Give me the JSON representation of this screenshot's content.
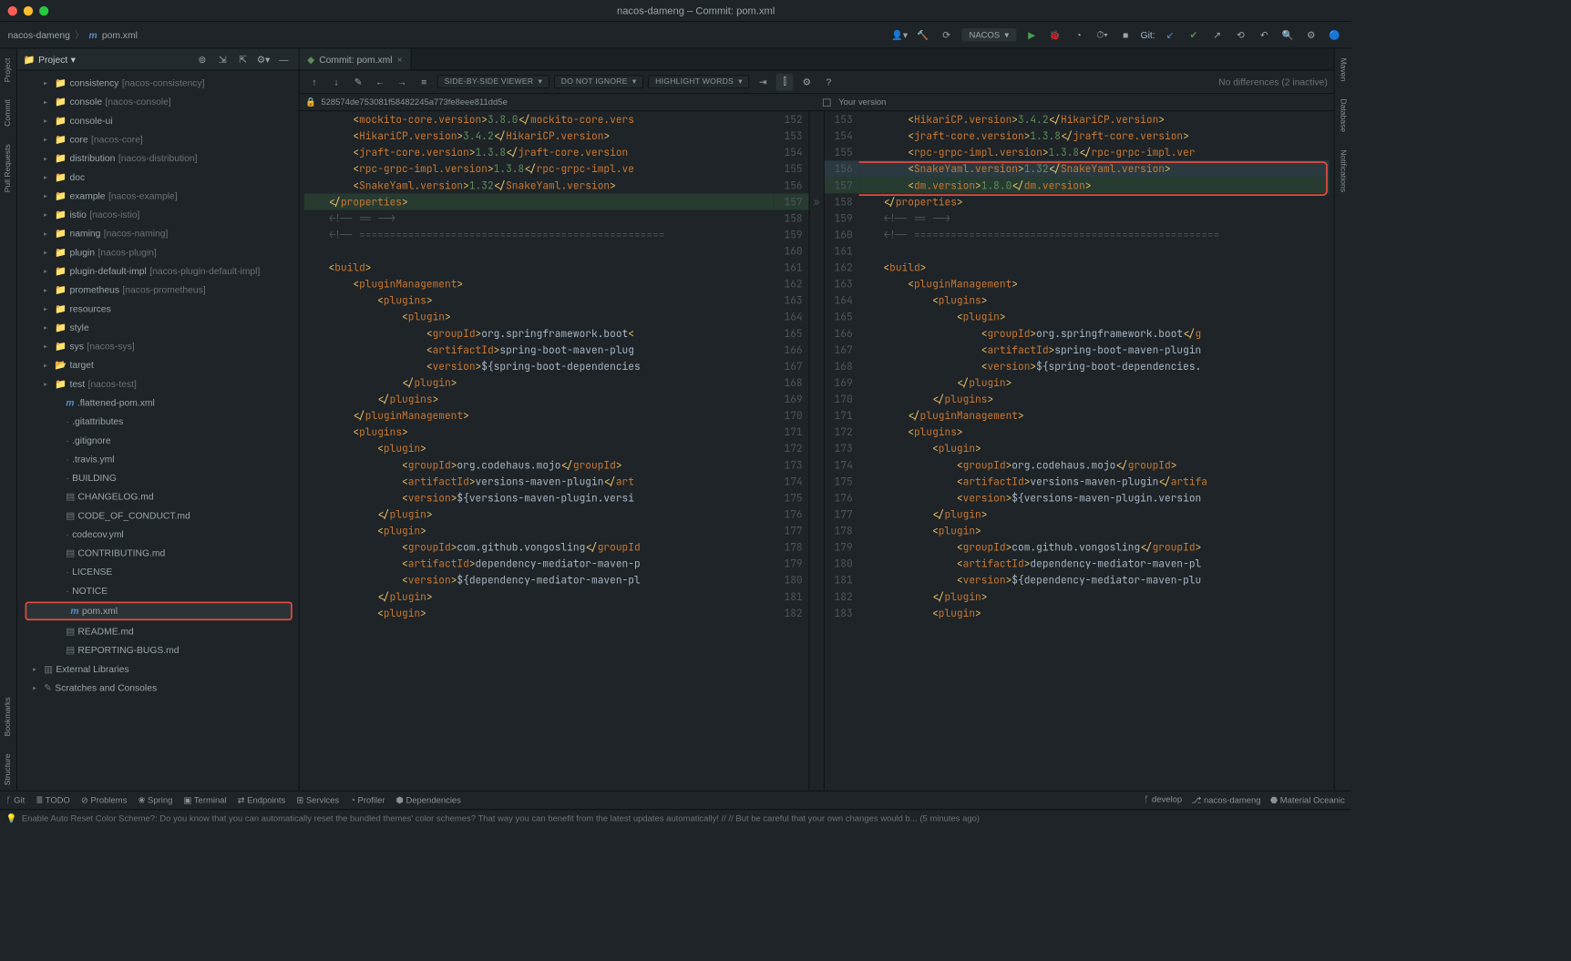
{
  "title": "nacos-dameng – Commit: pom.xml",
  "breadcrumb": {
    "project": "nacos-dameng",
    "file": "pom.xml"
  },
  "runConfig": {
    "label": "NACOS"
  },
  "gitLabel": "Git:",
  "panel": {
    "title": "Project"
  },
  "tree": [
    {
      "chev": "▸",
      "icon": "folder",
      "label": "consistency",
      "mod": "[nacos-consistency]",
      "indent": 2
    },
    {
      "chev": "▸",
      "icon": "folder",
      "label": "console",
      "mod": "[nacos-console]",
      "indent": 2
    },
    {
      "chev": "▸",
      "icon": "folder",
      "label": "console-ui",
      "mod": "",
      "indent": 2
    },
    {
      "chev": "▸",
      "icon": "folder",
      "label": "core",
      "mod": "[nacos-core]",
      "indent": 2
    },
    {
      "chev": "▸",
      "icon": "folder",
      "label": "distribution",
      "mod": "[nacos-distribution]",
      "indent": 2
    },
    {
      "chev": "▸",
      "icon": "folder",
      "label": "doc",
      "mod": "",
      "indent": 2
    },
    {
      "chev": "▸",
      "icon": "folder",
      "label": "example",
      "mod": "[nacos-example]",
      "indent": 2
    },
    {
      "chev": "▸",
      "icon": "folder",
      "label": "istio",
      "mod": "[nacos-istio]",
      "indent": 2
    },
    {
      "chev": "▸",
      "icon": "folder",
      "label": "naming",
      "mod": "[nacos-naming]",
      "indent": 2
    },
    {
      "chev": "▸",
      "icon": "folder",
      "label": "plugin",
      "mod": "[nacos-plugin]",
      "indent": 2
    },
    {
      "chev": "▸",
      "icon": "folder",
      "label": "plugin-default-impl",
      "mod": "[nacos-plugin-default-impl]",
      "indent": 2
    },
    {
      "chev": "▸",
      "icon": "folder",
      "label": "prometheus",
      "mod": "[nacos-prometheus]",
      "indent": 2
    },
    {
      "chev": "▸",
      "icon": "folder",
      "label": "resources",
      "mod": "",
      "indent": 2
    },
    {
      "chev": "▸",
      "icon": "folder",
      "label": "style",
      "mod": "",
      "indent": 2
    },
    {
      "chev": "▸",
      "icon": "folder",
      "label": "sys",
      "mod": "[nacos-sys]",
      "indent": 2
    },
    {
      "chev": "▸",
      "icon": "folder-open",
      "label": "target",
      "mod": "",
      "indent": 2
    },
    {
      "chev": "▸",
      "icon": "folder",
      "label": "test",
      "mod": "[nacos-test]",
      "indent": 2
    },
    {
      "chev": "",
      "icon": "m",
      "label": ".flattened-pom.xml",
      "mod": "",
      "indent": 3
    },
    {
      "chev": "",
      "icon": "file",
      "label": ".gitattributes",
      "mod": "",
      "indent": 3
    },
    {
      "chev": "",
      "icon": "file",
      "label": ".gitignore",
      "mod": "",
      "indent": 3
    },
    {
      "chev": "",
      "icon": "file",
      "label": ".travis.yml",
      "mod": "",
      "indent": 3
    },
    {
      "chev": "",
      "icon": "file",
      "label": "BUILDING",
      "mod": "",
      "indent": 3
    },
    {
      "chev": "",
      "icon": "md",
      "label": "CHANGELOG.md",
      "mod": "",
      "indent": 3
    },
    {
      "chev": "",
      "icon": "md",
      "label": "CODE_OF_CONDUCT.md",
      "mod": "",
      "indent": 3
    },
    {
      "chev": "",
      "icon": "file",
      "label": "codecov.yml",
      "mod": "",
      "indent": 3
    },
    {
      "chev": "",
      "icon": "md",
      "label": "CONTRIBUTING.md",
      "mod": "",
      "indent": 3
    },
    {
      "chev": "",
      "icon": "file",
      "label": "LICENSE",
      "mod": "",
      "indent": 3
    },
    {
      "chev": "",
      "icon": "file",
      "label": "NOTICE",
      "mod": "",
      "indent": 3
    },
    {
      "chev": "",
      "icon": "m",
      "label": "pom.xml",
      "mod": "",
      "indent": 3,
      "selected": true,
      "boxed": true
    },
    {
      "chev": "",
      "icon": "md",
      "label": "README.md",
      "mod": "",
      "indent": 3
    },
    {
      "chev": "",
      "icon": "md",
      "label": "REPORTING-BUGS.md",
      "mod": "",
      "indent": 3
    },
    {
      "chev": "▸",
      "icon": "lib",
      "label": "External Libraries",
      "mod": "",
      "indent": 1
    },
    {
      "chev": "▸",
      "icon": "scratch",
      "label": "Scratches and Consoles",
      "mod": "",
      "indent": 1
    }
  ],
  "tab": {
    "label": "Commit: pom.xml"
  },
  "diffToolbar": {
    "viewer": "SIDE-BY-SIDE VIEWER",
    "ignore": "DO NOT IGNORE",
    "highlight": "HIGHLIGHT WORDS",
    "noDiff": "No differences (2 inactive)"
  },
  "diffHead": {
    "leftHash": "528574de753081f58482245a773fe8eee811dd5e",
    "rightLabel": "Your version"
  },
  "leftLines": [
    {
      "n": 152,
      "html": "        <span class='tag'>&lt;</span><span class='tagname'>mockito-core.version</span><span class='tag'>&gt;</span><span class='text-val'>3.8.0</span><span class='tag'>&lt;/</span><span class='close-tag'>mockito-core.vers</span>"
    },
    {
      "n": 153,
      "html": "        <span class='tag'>&lt;</span><span class='tagname'>HikariCP.version</span><span class='tag'>&gt;</span><span class='text-val'>3.4.2</span><span class='tag'>&lt;/</span><span class='close-tag'>HikariCP.version</span><span class='tag'>&gt;</span>"
    },
    {
      "n": 154,
      "html": "        <span class='tag'>&lt;</span><span class='tagname'>jraft-core.version</span><span class='tag'>&gt;</span><span class='text-val'>1.3.8</span><span class='tag'>&lt;/</span><span class='close-tag'>jraft-core.version</span>"
    },
    {
      "n": 155,
      "html": "        <span class='tag'>&lt;</span><span class='tagname'>rpc-grpc-impl.version</span><span class='tag'>&gt;</span><span class='text-val'>1.3.8</span><span class='tag'>&lt;/</span><span class='close-tag'>rpc-grpc-impl.ve</span>"
    },
    {
      "n": 156,
      "html": "        <span class='tag'>&lt;</span><span class='tagname'>SnakeYaml.version</span><span class='tag'>&gt;</span><span class='text-val'>1.32</span><span class='tag'>&lt;/</span><span class='close-tag'>SnakeYaml.version</span><span class='tag'>&gt;</span>"
    },
    {
      "n": 157,
      "cls": "ins",
      "html": "    <span class='tag'>&lt;/</span><span class='close-tag'>properties</span><span class='tag'>&gt;</span>"
    },
    {
      "n": 158,
      "html": "    <span class='comm'>&lt;!-- == --&gt;</span>"
    },
    {
      "n": 159,
      "html": "    <span class='comm'>&lt;!-- ==================================================</span>"
    },
    {
      "n": 160,
      "html": ""
    },
    {
      "n": 161,
      "html": "    <span class='tag'>&lt;</span><span class='tagname'>build</span><span class='tag'>&gt;</span>"
    },
    {
      "n": 162,
      "html": "        <span class='tag'>&lt;</span><span class='tagname'>pluginManagement</span><span class='tag'>&gt;</span>"
    },
    {
      "n": 163,
      "html": "            <span class='tag'>&lt;</span><span class='tagname'>plugins</span><span class='tag'>&gt;</span>"
    },
    {
      "n": 164,
      "html": "                <span class='tag'>&lt;</span><span class='tagname'>plugin</span><span class='tag'>&gt;</span>"
    },
    {
      "n": 165,
      "html": "                    <span class='tag'>&lt;</span><span class='tagname'>groupId</span><span class='tag'>&gt;</span><span class='attr'>org.springframework.boot</span><span class='tag'>&lt;</span>"
    },
    {
      "n": 166,
      "html": "                    <span class='tag'>&lt;</span><span class='tagname'>artifactId</span><span class='tag'>&gt;</span><span class='attr'>spring-boot-maven-plug</span>"
    },
    {
      "n": 167,
      "html": "                    <span class='tag'>&lt;</span><span class='tagname'>version</span><span class='tag'>&gt;</span><span class='attr'>${spring-boot-dependencies</span>"
    },
    {
      "n": 168,
      "html": "                <span class='tag'>&lt;/</span><span class='close-tag'>plugin</span><span class='tag'>&gt;</span>"
    },
    {
      "n": 169,
      "html": "            <span class='tag'>&lt;/</span><span class='close-tag'>plugins</span><span class='tag'>&gt;</span>"
    },
    {
      "n": 170,
      "html": "        <span class='tag'>&lt;/</span><span class='close-tag'>pluginManagement</span><span class='tag'>&gt;</span>"
    },
    {
      "n": 171,
      "html": "        <span class='tag'>&lt;</span><span class='tagname'>plugins</span><span class='tag'>&gt;</span>"
    },
    {
      "n": 172,
      "html": "            <span class='tag'>&lt;</span><span class='tagname'>plugin</span><span class='tag'>&gt;</span>"
    },
    {
      "n": 173,
      "html": "                <span class='tag'>&lt;</span><span class='tagname'>groupId</span><span class='tag'>&gt;</span><span class='attr'>org.codehaus.mojo</span><span class='tag'>&lt;/</span><span class='close-tag'>groupId</span><span class='tag'>&gt;</span>"
    },
    {
      "n": 174,
      "html": "                <span class='tag'>&lt;</span><span class='tagname'>artifactId</span><span class='tag'>&gt;</span><span class='attr'>versions-maven-plugin</span><span class='tag'>&lt;/</span><span class='close-tag'>art</span>"
    },
    {
      "n": 175,
      "html": "                <span class='tag'>&lt;</span><span class='tagname'>version</span><span class='tag'>&gt;</span><span class='attr'>${versions-maven-plugin.versi</span>"
    },
    {
      "n": 176,
      "html": "            <span class='tag'>&lt;/</span><span class='close-tag'>plugin</span><span class='tag'>&gt;</span>"
    },
    {
      "n": 177,
      "html": "            <span class='tag'>&lt;</span><span class='tagname'>plugin</span><span class='tag'>&gt;</span>"
    },
    {
      "n": 178,
      "html": "                <span class='tag'>&lt;</span><span class='tagname'>groupId</span><span class='tag'>&gt;</span><span class='attr'>com.github.vongosling</span><span class='tag'>&lt;/</span><span class='close-tag'>groupId</span>"
    },
    {
      "n": 179,
      "html": "                <span class='tag'>&lt;</span><span class='tagname'>artifactId</span><span class='tag'>&gt;</span><span class='attr'>dependency-mediator-maven-p</span>"
    },
    {
      "n": 180,
      "html": "                <span class='tag'>&lt;</span><span class='tagname'>version</span><span class='tag'>&gt;</span><span class='attr'>${dependency-mediator-maven-pl</span>"
    },
    {
      "n": 181,
      "html": "            <span class='tag'>&lt;/</span><span class='close-tag'>plugin</span><span class='tag'>&gt;</span>"
    },
    {
      "n": 182,
      "html": "            <span class='tag'>&lt;</span><span class='tagname'>plugin</span><span class='tag'>&gt;</span>"
    }
  ],
  "rightLines": [
    {
      "n": 153,
      "html": "        <span class='tag'>&lt;</span><span class='tagname'>HikariCP.version</span><span class='tag'>&gt;</span><span class='text-val'>3.4.2</span><span class='tag'>&lt;/</span><span class='close-tag'>HikariCP.version</span><span class='tag'>&gt;</span>"
    },
    {
      "n": 154,
      "html": "        <span class='tag'>&lt;</span><span class='tagname'>jraft-core.version</span><span class='tag'>&gt;</span><span class='text-val'>1.3.8</span><span class='tag'>&lt;/</span><span class='close-tag'>jraft-core.version</span><span class='tag'>&gt;</span>"
    },
    {
      "n": 155,
      "html": "        <span class='tag'>&lt;</span><span class='tagname'>rpc-grpc-impl.version</span><span class='tag'>&gt;</span><span class='text-val'>1.3.8</span><span class='tag'>&lt;/</span><span class='close-tag'>rpc-grpc-impl.ver</span>"
    },
    {
      "n": 156,
      "cls": "mod",
      "html": "        <span class='tag'>&lt;</span><span class='tagname'>SnakeYaml.version</span><span class='tag'>&gt;</span><span class='text-val'>1.32</span><span class='tag'>&lt;/</span><span class='close-tag'>SnakeYaml.version</span><span class='tag'>&gt;</span>"
    },
    {
      "n": 157,
      "cls": "ins",
      "html": "        <span class='tag'>&lt;</span><span class='tagname'>dm.version</span><span class='tag'>&gt;</span><span class='text-val'>1.8.0</span><span class='tag'>&lt;/</span><span class='close-tag'>dm.version</span><span class='tag'>&gt;</span>"
    },
    {
      "n": 158,
      "html": "    <span class='tag'>&lt;/</span><span class='close-tag'>properties</span><span class='tag'>&gt;</span>"
    },
    {
      "n": 159,
      "html": "    <span class='comm'>&lt;!-- == --&gt;</span>"
    },
    {
      "n": 160,
      "html": "    <span class='comm'>&lt;!-- ==================================================</span>"
    },
    {
      "n": 161,
      "html": ""
    },
    {
      "n": 162,
      "html": "    <span class='tag'>&lt;</span><span class='tagname'>build</span><span class='tag'>&gt;</span>"
    },
    {
      "n": 163,
      "html": "        <span class='tag'>&lt;</span><span class='tagname'>pluginManagement</span><span class='tag'>&gt;</span>"
    },
    {
      "n": 164,
      "html": "            <span class='tag'>&lt;</span><span class='tagname'>plugins</span><span class='tag'>&gt;</span>"
    },
    {
      "n": 165,
      "html": "                <span class='tag'>&lt;</span><span class='tagname'>plugin</span><span class='tag'>&gt;</span>"
    },
    {
      "n": 166,
      "html": "                    <span class='tag'>&lt;</span><span class='tagname'>groupId</span><span class='tag'>&gt;</span><span class='attr'>org.springframework.boot</span><span class='tag'>&lt;/</span><span class='close-tag'>g</span>"
    },
    {
      "n": 167,
      "html": "                    <span class='tag'>&lt;</span><span class='tagname'>artifactId</span><span class='tag'>&gt;</span><span class='attr'>spring-boot-maven-plugin</span>"
    },
    {
      "n": 168,
      "html": "                    <span class='tag'>&lt;</span><span class='tagname'>version</span><span class='tag'>&gt;</span><span class='attr'>${spring-boot-dependencies.</span>"
    },
    {
      "n": 169,
      "html": "                <span class='tag'>&lt;/</span><span class='close-tag'>plugin</span><span class='tag'>&gt;</span>"
    },
    {
      "n": 170,
      "html": "            <span class='tag'>&lt;/</span><span class='close-tag'>plugins</span><span class='tag'>&gt;</span>"
    },
    {
      "n": 171,
      "html": "        <span class='tag'>&lt;/</span><span class='close-tag'>pluginManagement</span><span class='tag'>&gt;</span>"
    },
    {
      "n": 172,
      "html": "        <span class='tag'>&lt;</span><span class='tagname'>plugins</span><span class='tag'>&gt;</span>"
    },
    {
      "n": 173,
      "html": "            <span class='tag'>&lt;</span><span class='tagname'>plugin</span><span class='tag'>&gt;</span>"
    },
    {
      "n": 174,
      "html": "                <span class='tag'>&lt;</span><span class='tagname'>groupId</span><span class='tag'>&gt;</span><span class='attr'>org.codehaus.mojo</span><span class='tag'>&lt;/</span><span class='close-tag'>groupId</span><span class='tag'>&gt;</span>"
    },
    {
      "n": 175,
      "html": "                <span class='tag'>&lt;</span><span class='tagname'>artifactId</span><span class='tag'>&gt;</span><span class='attr'>versions-maven-plugin</span><span class='tag'>&lt;/</span><span class='close-tag'>artifa</span>"
    },
    {
      "n": 176,
      "html": "                <span class='tag'>&lt;</span><span class='tagname'>version</span><span class='tag'>&gt;</span><span class='attr'>${versions-maven-plugin.version</span>"
    },
    {
      "n": 177,
      "html": "            <span class='tag'>&lt;/</span><span class='close-tag'>plugin</span><span class='tag'>&gt;</span>"
    },
    {
      "n": 178,
      "html": "            <span class='tag'>&lt;</span><span class='tagname'>plugin</span><span class='tag'>&gt;</span>"
    },
    {
      "n": 179,
      "html": "                <span class='tag'>&lt;</span><span class='tagname'>groupId</span><span class='tag'>&gt;</span><span class='attr'>com.github.vongosling</span><span class='tag'>&lt;/</span><span class='close-tag'>groupId</span><span class='tag'>&gt;</span>"
    },
    {
      "n": 180,
      "html": "                <span class='tag'>&lt;</span><span class='tagname'>artifactId</span><span class='tag'>&gt;</span><span class='attr'>dependency-mediator-maven-pl</span>"
    },
    {
      "n": 181,
      "html": "                <span class='tag'>&lt;</span><span class='tagname'>version</span><span class='tag'>&gt;</span><span class='attr'>${dependency-mediator-maven-plu</span>"
    },
    {
      "n": 182,
      "html": "            <span class='tag'>&lt;/</span><span class='close-tag'>plugin</span><span class='tag'>&gt;</span>"
    },
    {
      "n": 183,
      "html": "            <span class='tag'>&lt;</span><span class='tagname'>plugin</span><span class='tag'>&gt;</span>"
    }
  ],
  "statusBar": {
    "items": [
      "Git",
      "TODO",
      "Problems",
      "Spring",
      "Terminal",
      "Endpoints",
      "Services",
      "Profiler",
      "Dependencies"
    ],
    "right": [
      "develop",
      "nacos-dameng",
      "Material Oceanic"
    ]
  },
  "tip": "Enable Auto Reset Color Scheme?: Do you know that you can automatically reset the bundled themes' color schemes? That way you can benefit from the latest updates automatically! // // But be careful that your own changes would b... (5 minutes ago)",
  "sideRails": {
    "left": [
      "Project",
      "Commit",
      "Pull Requests",
      "Bookmarks",
      "Structure"
    ],
    "right": [
      "Maven",
      "Database",
      "Notifications"
    ]
  }
}
